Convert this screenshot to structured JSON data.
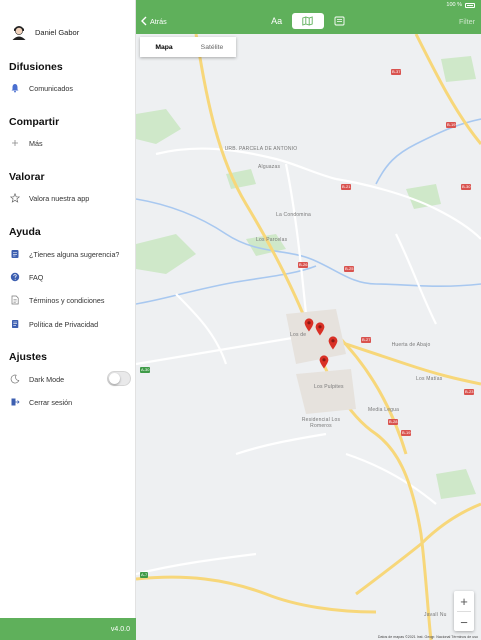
{
  "sidebar": {
    "user_name": "Daniel Gabor",
    "sections": [
      {
        "title": "Difusiones",
        "items": [
          {
            "label": "Comunicados",
            "icon": "bell-icon"
          }
        ]
      },
      {
        "title": "Compartir",
        "items": [
          {
            "label": "Más",
            "icon": "plus-icon"
          }
        ]
      },
      {
        "title": "Valorar",
        "items": [
          {
            "label": "Valora nuestra app",
            "icon": "star-icon"
          }
        ]
      },
      {
        "title": "Ayuda",
        "items": [
          {
            "label": "¿Tienes alguna sugerencia?",
            "icon": "suggestion-icon"
          },
          {
            "label": "FAQ",
            "icon": "question-icon"
          },
          {
            "label": "Términos y condiciones",
            "icon": "document-icon"
          },
          {
            "label": "Política de Privacidad",
            "icon": "privacy-icon"
          }
        ]
      },
      {
        "title": "Ajustes",
        "items": [
          {
            "label": "Dark Mode",
            "icon": "moon-icon"
          },
          {
            "label": "Cerrar sesión",
            "icon": "logout-icon"
          }
        ]
      }
    ],
    "dark_mode_enabled": false,
    "version": "v4.0.0"
  },
  "navbar": {
    "status_battery": "100 %",
    "back_label": "Atrás",
    "segments": [
      {
        "label": "Aa",
        "active": false
      },
      {
        "icon": "map-icon",
        "active": true
      },
      {
        "icon": "list-icon",
        "active": false
      }
    ],
    "filter_label": "Filter"
  },
  "map": {
    "map_type": {
      "options": [
        "Mapa",
        "Satélite"
      ],
      "selected": "Mapa"
    },
    "place_labels": {
      "urbanizacion": "URB. PARCELA DE ANTONIO",
      "alguazas": "Alguazas",
      "condomina": "La Condomina",
      "parcelas": "Los Parcelas",
      "losde": "Los de",
      "pulpites": "Los Pulpites",
      "huerta": "Huerta de Abajo",
      "matias": "Los Matías",
      "media_legua": "Media Legua",
      "residencial": "Residencial Los Romeros",
      "javali": "Javalí Nu"
    },
    "road_labels": {
      "b1": "B-37",
      "b2": "B-19",
      "b3": "B-30",
      "b4": "B-21",
      "b5": "B-26",
      "b6": "B-25",
      "b7": "B-27",
      "b8": "B-23",
      "b9": "B-28",
      "b10": "B-19",
      "g1": "A-30",
      "g2": "A-7"
    },
    "markers": [
      {
        "label": "marker-1"
      },
      {
        "label": "marker-2"
      },
      {
        "label": "marker-3"
      },
      {
        "label": "marker-4"
      }
    ],
    "attribution": "Datos de mapas ©2021 Inst. Geogr. Nacional   Términos de uso",
    "zoom_in": "+",
    "zoom_out": "−"
  }
}
